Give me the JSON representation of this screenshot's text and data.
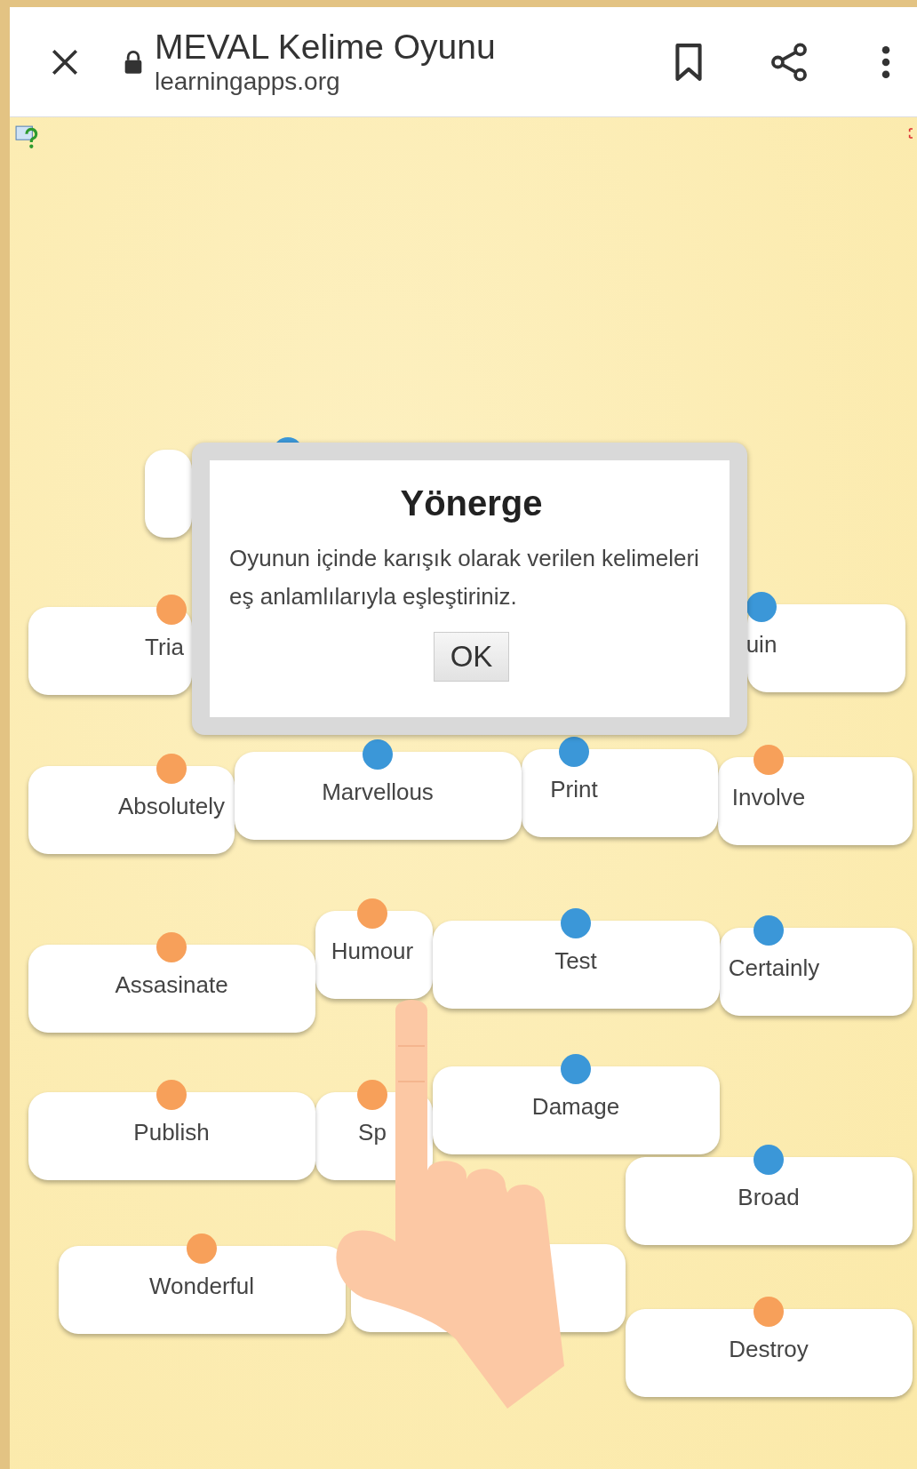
{
  "browser": {
    "title": "MEVAL Kelime Oyunu",
    "url": "learningapps.org"
  },
  "cards": [
    {
      "kind": "blank",
      "color": "#3b97d8"
    },
    {
      "kind": "word",
      "text": "Tria",
      "color": "#f7a05a"
    },
    {
      "kind": "word",
      "text": "uin",
      "color": "#3b97d8"
    },
    {
      "kind": "word",
      "text": "Absolutely",
      "color": "#f7a05a"
    },
    {
      "kind": "word",
      "text": "Marvellous",
      "color": "#3b97d8"
    },
    {
      "kind": "word",
      "text": "Print",
      "color": "#3b97d8"
    },
    {
      "kind": "word",
      "text": "Involve",
      "color": "#f7a05a"
    },
    {
      "kind": "word",
      "text": "Humour",
      "color": "#f7a05a"
    },
    {
      "kind": "word",
      "text": "Assasinate",
      "color": "#f7a05a"
    },
    {
      "kind": "word",
      "text": "Test",
      "color": "#3b97d8"
    },
    {
      "kind": "word",
      "text": "Certainly",
      "color": "#3b97d8"
    },
    {
      "kind": "word",
      "text": "Publish",
      "color": "#f7a05a"
    },
    {
      "kind": "word",
      "text": "Sp",
      "color": "#f7a05a"
    },
    {
      "kind": "word",
      "text": "Damage",
      "color": "#3b97d8"
    },
    {
      "kind": "word",
      "text": "Broad",
      "color": "#3b97d8"
    },
    {
      "kind": "word",
      "text": "Wonderful",
      "color": "#f7a05a"
    },
    {
      "kind": "blank"
    },
    {
      "kind": "word",
      "text": "Destroy",
      "color": "#f7a05a"
    }
  ],
  "dialog": {
    "title": "Yönerge",
    "message": "Oyunun içinde karışık olarak verilen kelimeleri eş anlamlılarıyla eşleştiriniz.",
    "button": "OK"
  }
}
